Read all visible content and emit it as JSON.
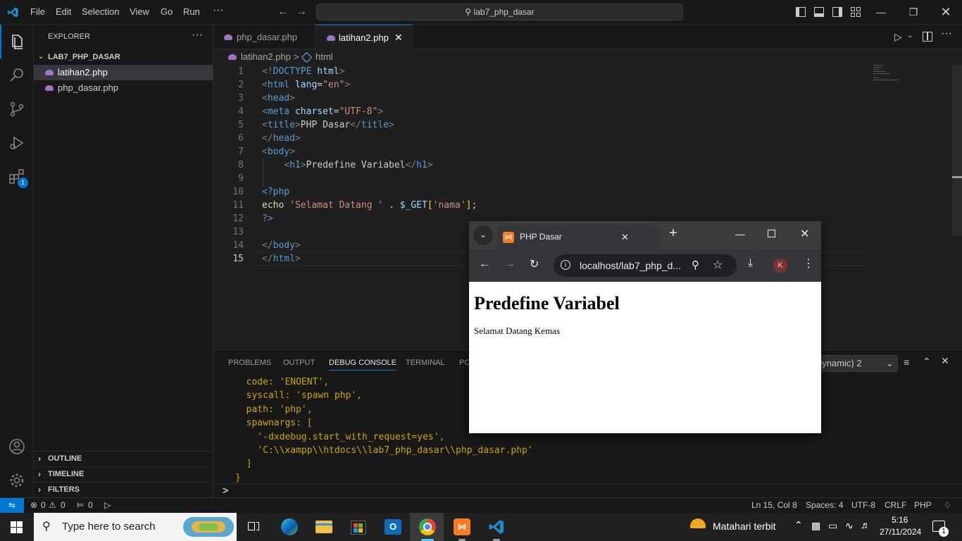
{
  "titlebar": {
    "menu": [
      "File",
      "Edit",
      "Selection",
      "View",
      "Go",
      "Run",
      "···"
    ],
    "search_text": "lab7_php_dasar"
  },
  "sidebar": {
    "title": "EXPLORER",
    "more": "···",
    "folder": "LAB7_PHP_DASAR",
    "files": [
      "latihan2.php",
      "php_dasar.php"
    ],
    "sections": [
      "OUTLINE",
      "TIMELINE",
      "FILTERS"
    ]
  },
  "activitybar": {
    "extensions_badge": "1"
  },
  "tabs": [
    {
      "label": "php_dasar.php",
      "active": false
    },
    {
      "label": "latihan2.php",
      "active": true
    }
  ],
  "breadcrumbs": {
    "file": "latihan2.php",
    "separator": ">",
    "symbol": "html"
  },
  "editor": {
    "line_numbers": [
      "1",
      "2",
      "3",
      "4",
      "5",
      "6",
      "7",
      "8",
      "9",
      "10",
      "11",
      "12",
      "13",
      "14",
      "15"
    ]
  },
  "panel": {
    "tabs": [
      "PROBLEMS",
      "OUTPUT",
      "DEBUG CONSOLE",
      "TERMINAL",
      "PO"
    ],
    "active_tab": "DEBUG CONSOLE",
    "dropdown_label": "dynamic) 2",
    "console_lines": [
      "  code: 'ENOENT',",
      "  syscall: 'spawn php',",
      "  path: 'php',",
      "  spawnargs: [",
      "    '-dxdebug.start_with_request=yes',",
      "    'C:\\\\xampp\\\\htdocs\\\\lab7_php_dasar\\\\php_dasar.php'",
      "  ]",
      "}"
    ],
    "prompt": ">"
  },
  "statusbar": {
    "errors": "0",
    "warnings": "0",
    "ports": "0",
    "position": "Ln 15, Col 8",
    "spaces": "Spaces: 4",
    "encoding": "UTF-8",
    "eol": "CRLF",
    "language": "PHP"
  },
  "taskbar": {
    "search_placeholder": "Type here to search",
    "weather": "Matahari terbit",
    "time": "5:16",
    "date": "27/11/2024",
    "notification_count": "1"
  },
  "chrome": {
    "tab_title": "PHP Dasar",
    "url": "localhost/lab7_php_d...",
    "profile_initial": "K",
    "page_heading": "Predefine Variabel",
    "page_text": "Selamat Datang Kemas"
  },
  "colors": {
    "accent": "#0078d4",
    "vscode_blue": "#007acc",
    "console_yellow": "#cca700"
  }
}
